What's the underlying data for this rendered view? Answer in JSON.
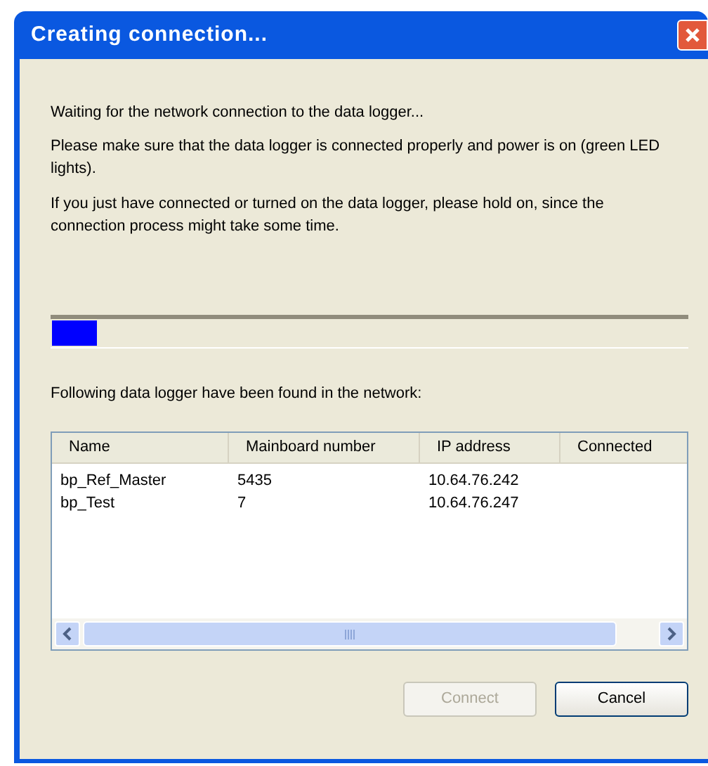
{
  "window": {
    "title": "Creating connection..."
  },
  "messages": [
    "Waiting for the network connection to the data logger...",
    "Please make sure that the data logger is connected properly and power is on (green LED lights).",
    "If you just have connected or turned on the data logger, please hold on, since the connection process might take some time."
  ],
  "progress": {
    "level": 0.07
  },
  "found_label": "Following data logger have been found in the network:",
  "table": {
    "columns": [
      "Name",
      "Mainboard number",
      "IP address",
      "Connected"
    ],
    "rows": [
      [
        "bp_Ref_Master",
        "5435",
        "10.64.76.242"
      ],
      [
        "bp_Test",
        "7",
        "10.64.76.247"
      ]
    ]
  },
  "buttons": [
    {
      "label": "Connect",
      "disabled": true
    },
    {
      "label": "Cancel",
      "disabled": false
    }
  ]
}
